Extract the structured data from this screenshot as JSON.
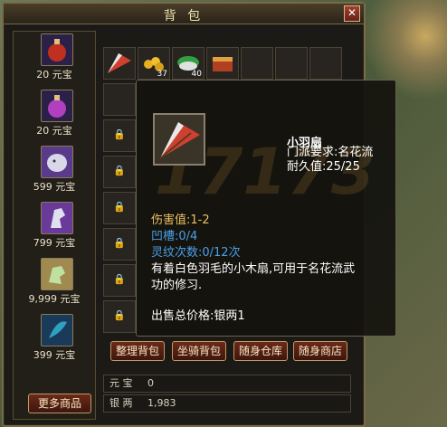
{
  "window": {
    "title": "背 包",
    "close_glyph": "✕"
  },
  "shop": {
    "items": [
      {
        "icon": "red-potion-icon",
        "price": "20 元宝",
        "color": "#c03020"
      },
      {
        "icon": "purple-potion-icon",
        "price": "20 元宝",
        "color": "#b040c0"
      },
      {
        "icon": "white-lion-mount-icon",
        "price": "599 元宝",
        "color": "#d8d8e8"
      },
      {
        "icon": "white-horse-mount-icon",
        "price": "799 元宝",
        "color": "#e0e0f0"
      },
      {
        "icon": "green-pegasus-mount-icon",
        "price": "9,999 元宝",
        "color": "#c0e0a0"
      },
      {
        "icon": "blue-feather-icon",
        "price": "399 元宝",
        "color": "#30a0c0"
      }
    ],
    "more_label": "更多商品"
  },
  "inventory": {
    "top_slots": [
      {
        "icon": "feather-fan-icon",
        "count": ""
      },
      {
        "icon": "gold-coins-icon",
        "count": "37"
      },
      {
        "icon": "green-herb-icon",
        "count": "40"
      },
      {
        "icon": "treasure-chest-icon",
        "count": ""
      }
    ],
    "locked_glyph": "🔒"
  },
  "buttons": {
    "sort": "整理背包",
    "mount_bag": "坐骑背包",
    "storage": "随身仓库",
    "shop": "随身商店"
  },
  "money": {
    "yuanbao_label": "元 宝",
    "yuanbao_value": "0",
    "silver_label": "银 两",
    "silver_value": "1,983"
  },
  "tooltip": {
    "name": "小羽扇",
    "requirement": "门派要求:名花流",
    "durability": "耐久值:25/25",
    "damage": "伤害值:1-2",
    "sockets": "凹槽:0/4",
    "rune_count": "灵纹次数:0/12次",
    "description_line1": "有着白色羽毛的小木扇,可用于名花流武",
    "description_line2": "功的修习.",
    "sell_price": "出售总价格:银两1",
    "watermark": "17173"
  },
  "colors": {
    "gold_text": "#e8c060",
    "blue_text": "#4aa0e8",
    "white_text": "#ffffff"
  }
}
